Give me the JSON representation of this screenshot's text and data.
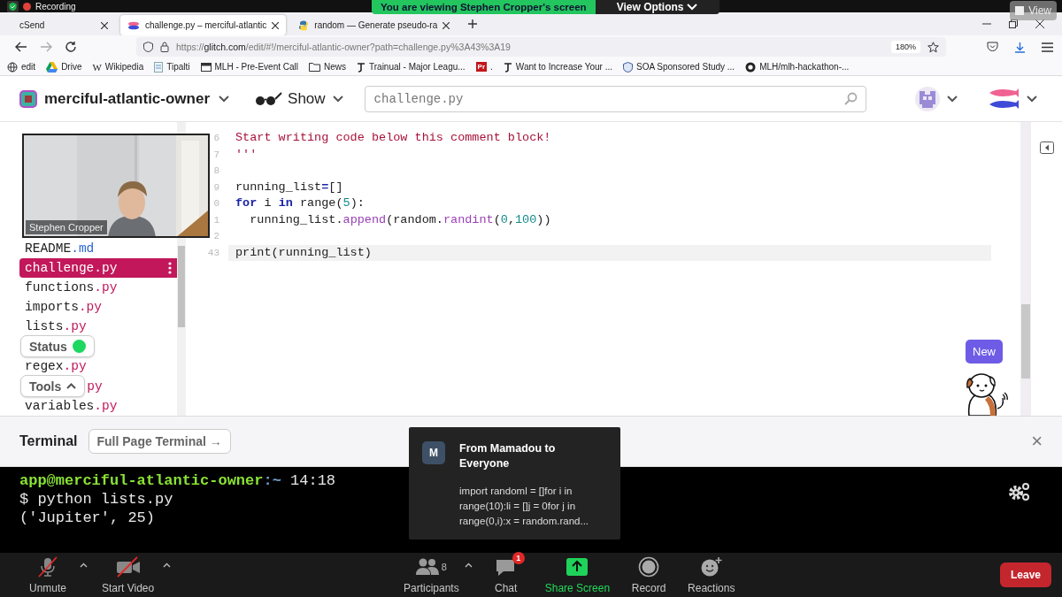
{
  "zoom_banner": {
    "viewing": "You are viewing Stephen Cropper's screen",
    "options": "View Options"
  },
  "recording": {
    "label": "Recording"
  },
  "view_button": {
    "label": "View"
  },
  "browser": {
    "tabs": [
      {
        "label": "cSend",
        "selected": false
      },
      {
        "label": "challenge.py – merciful-atlantic",
        "selected": true
      },
      {
        "label": "random — Generate pseudo-ra",
        "selected": false
      }
    ],
    "url": {
      "prefix": "https://",
      "host": "glitch.com",
      "path": "/edit/#!/merciful-atlantic-owner?path=challenge.py%3A43%3A19"
    },
    "zoom": "180%",
    "bookmarks": [
      {
        "label": "edit"
      },
      {
        "label": "Drive"
      },
      {
        "label": "Wikipedia",
        "glyph": "W"
      },
      {
        "label": "Tipalti"
      },
      {
        "label": "MLH - Pre-Event Call"
      },
      {
        "label": "News"
      },
      {
        "label": "Trainual - Major Leagu..."
      },
      {
        "label": ".",
        "glyph": "Pr"
      },
      {
        "label": "Want to Increase Your ..."
      },
      {
        "label": "SOA Sponsored Study ..."
      },
      {
        "label": "MLH/mlh-hackathon-..."
      }
    ]
  },
  "glitch": {
    "project": "merciful-atlantic-owner",
    "show": "Show",
    "search_placeholder": "challenge.py"
  },
  "video": {
    "name": "Stephen Cropper"
  },
  "sidebar": {
    "items": [
      {
        "kind": "file",
        "name": "README",
        "ext": ".md",
        "color": "#2a63d4",
        "selected": false
      },
      {
        "kind": "file",
        "name": "challenge",
        "ext": ".py",
        "color": "#c2185b",
        "selected": true
      },
      {
        "kind": "file",
        "name": "functions",
        "ext": ".py",
        "color": "#c2185b",
        "selected": false
      },
      {
        "kind": "file",
        "name": "imports",
        "ext": ".py",
        "color": "#c2185b",
        "selected": false
      },
      {
        "kind": "file",
        "name": "lists",
        "ext": ".py",
        "color": "#c2185b",
        "selected": false
      },
      {
        "kind": "status",
        "label": "Status"
      },
      {
        "kind": "file",
        "name": "regex",
        "ext": ".py",
        "color": "#c2185b",
        "selected": false
      },
      {
        "kind": "tools",
        "label": "Tools",
        "ext": "py",
        "color": "#c2185b"
      },
      {
        "kind": "file",
        "name": "variables",
        "ext": ".py",
        "color": "#c2185b",
        "selected": false
      }
    ]
  },
  "editor": {
    "lines": [
      {
        "number": "6",
        "current": false,
        "tokens": [
          {
            "kind": "string",
            "text": "Start writing code below this comment block!"
          }
        ]
      },
      {
        "number": "7",
        "current": false,
        "tokens": [
          {
            "kind": "string",
            "text": "'''"
          }
        ]
      },
      {
        "number": "8",
        "current": false
      },
      {
        "number": "9",
        "current": false,
        "tokens": [
          {
            "kind": "plain",
            "text": "running_list"
          },
          {
            "kind": "op",
            "text": "="
          },
          {
            "kind": "plain",
            "text": "[]"
          }
        ]
      },
      {
        "number": "0",
        "current": false,
        "tokens": [
          {
            "kind": "keyword",
            "text": "for"
          },
          {
            "kind": "plain",
            "text": " i "
          },
          {
            "kind": "keyword",
            "text": "in"
          },
          {
            "kind": "plain",
            "text": " range("
          },
          {
            "kind": "number",
            "text": "5"
          },
          {
            "kind": "plain",
            "text": "):"
          }
        ]
      },
      {
        "number": "1",
        "current": false,
        "tokens": [
          {
            "kind": "plain",
            "text": "  running_list."
          },
          {
            "kind": "function",
            "text": "append"
          },
          {
            "kind": "plain",
            "text": "(random."
          },
          {
            "kind": "function",
            "text": "randint"
          },
          {
            "kind": "plain",
            "text": "("
          },
          {
            "kind": "number",
            "text": "0"
          },
          {
            "kind": "plain",
            "text": ","
          },
          {
            "kind": "number",
            "text": "100"
          },
          {
            "kind": "plain",
            "text": "))"
          }
        ]
      },
      {
        "number": "2",
        "current": false
      },
      {
        "number": "43",
        "current": true,
        "tokens": [
          {
            "kind": "plain",
            "text": "print(running_list)"
          }
        ]
      }
    ]
  },
  "new_bubble": "New",
  "terminal": {
    "title": "Terminal",
    "full_page": "Full Page Terminal →",
    "close": "×",
    "user": "app@merciful-atlantic-owner",
    "path": ":~",
    "time": " 14:18",
    "lines": [
      "$ python lists.py",
      "('Jupiter', 25)"
    ]
  },
  "chat_popup": {
    "initial": "M",
    "title": "From Mamadou to Everyone",
    "message": "import randoml = []for i in range(10):li = []j = 0for j in range(0,i):x = random.rand..."
  },
  "toolbar": {
    "items": [
      {
        "kind": "mic",
        "label": "Unmute",
        "off": true,
        "caret": true
      },
      {
        "kind": "video",
        "label": "Start Video",
        "off": true,
        "caret": true
      },
      {
        "kind": "participants",
        "label": "Participants",
        "count": "8",
        "caret": true
      },
      {
        "kind": "chat",
        "label": "Chat",
        "badge": "1",
        "caret": false
      },
      {
        "kind": "share",
        "label": "Share Screen",
        "caret": false
      },
      {
        "kind": "record",
        "label": "Record",
        "caret": false
      },
      {
        "kind": "reactions",
        "label": "Reactions",
        "caret": false
      }
    ],
    "leave": "Leave"
  }
}
